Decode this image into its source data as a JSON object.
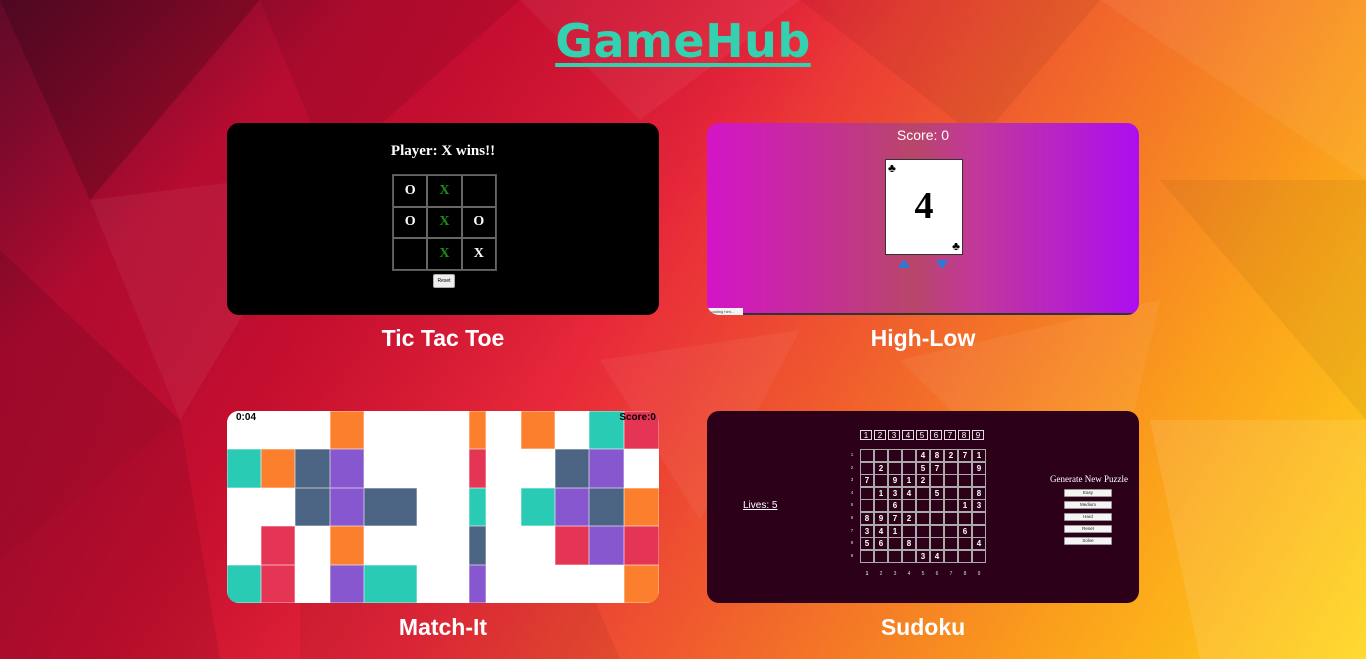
{
  "app": {
    "title": "GameHub"
  },
  "games": {
    "tictactoe": {
      "label": "Tic Tac Toe",
      "status": "Player: X wins!!",
      "board": [
        "O",
        "X",
        "",
        "O",
        "X",
        "O",
        "",
        "X",
        "X"
      ],
      "reset_label": "Reset"
    },
    "highlow": {
      "label": "High-Low",
      "score_text": "Score: 0",
      "card_rank": "4",
      "card_suit": "♣",
      "footer_text": "Loading hint..."
    },
    "matchit": {
      "label": "Match-It",
      "timer": "0:04",
      "score": "Score:0",
      "colors": {
        "O": "#fb7f2d",
        "T": "#2acbb5",
        "S": "#4b6484",
        "P": "#8757cf",
        "R": "#e53554",
        "W": "#ffffff"
      },
      "rows": [
        "WWWOWWOWOWTR",
        "TOSPWWRWWSPW",
        "WWSPSWTWTPSO",
        "WRWOWWSWWRPR",
        "TRWPTWPWWWWO"
      ]
    },
    "sudoku": {
      "label": "Sudoku",
      "lives": "Lives: 5",
      "generate_title": "Generate New Puzzle",
      "buttons": [
        "Easy",
        "Medium",
        "Hard",
        "Reset",
        "Solve"
      ],
      "col_headers": [
        "1",
        "2",
        "3",
        "4",
        "5",
        "6",
        "7",
        "8",
        "9"
      ],
      "grid": [
        [
          "",
          "",
          "",
          "",
          "4",
          "8",
          "2",
          "7",
          "1"
        ],
        [
          "",
          "2",
          "",
          "",
          "5",
          "7",
          "",
          "",
          "9"
        ],
        [
          "7",
          "",
          "9",
          "1",
          "2",
          "",
          "",
          "",
          ""
        ],
        [
          "",
          "1",
          "3",
          "4",
          "",
          "5",
          "",
          "",
          "8"
        ],
        [
          "",
          "",
          "6",
          "",
          "",
          "",
          "",
          "1",
          "3"
        ],
        [
          "8",
          "9",
          "7",
          "2",
          "",
          "",
          "",
          "",
          ""
        ],
        [
          "3",
          "4",
          "1",
          "",
          "",
          "",
          "",
          "6",
          ""
        ],
        [
          "5",
          "6",
          "",
          "8",
          "",
          "",
          "",
          "",
          "4"
        ],
        [
          "",
          "",
          "",
          "",
          "3",
          "4",
          "",
          "",
          ""
        ]
      ],
      "row_numbers": [
        "1",
        "2",
        "3",
        "4",
        "5",
        "6",
        "7",
        "8",
        "9"
      ],
      "bottom_numbers": [
        "1",
        "2",
        "3",
        "4",
        "5",
        "6",
        "7",
        "8",
        "9"
      ]
    }
  }
}
